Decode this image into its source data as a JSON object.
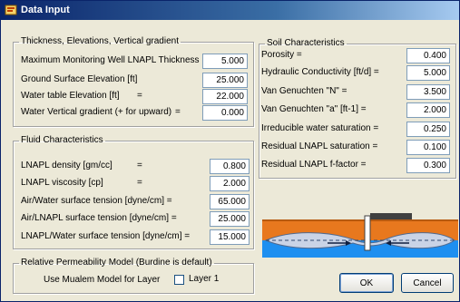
{
  "window": {
    "title": "Data Input",
    "icon": "app-window-icon"
  },
  "thickness_group": {
    "legend": "Thickness, Elevations, Vertical gradient",
    "fields": [
      {
        "label": "Maximum Monitoring Well LNAPL Thickness [ft] =",
        "value": "5.000"
      },
      {
        "label": "Ground Surface Elevation [ft]",
        "value": "25.000"
      },
      {
        "label": "Water table Elevation [ft]",
        "value": "22.000"
      },
      {
        "label": "Water Vertical gradient (+ for upward)",
        "value": "0.000"
      }
    ],
    "eq": "="
  },
  "fluid_group": {
    "legend": "Fluid Characteristics",
    "fields": [
      {
        "label": "LNAPL density [gm/cc]",
        "eq": "=",
        "value": "0.800"
      },
      {
        "label": "LNAPL viscosity [cp]",
        "eq": "=",
        "value": "2.000"
      },
      {
        "label": "Air/Water surface tension [dyne/cm]  =",
        "value": "65.000"
      },
      {
        "label": "Air/LNAPL surface tension [dyne/cm]  =",
        "value": "25.000"
      },
      {
        "label": "LNAPL/Water surface tension [dyne/cm] =",
        "value": "15.000"
      }
    ]
  },
  "soil_group": {
    "legend": "Soil Characteristics",
    "fields": [
      {
        "label": "Porosity =",
        "value": "0.400"
      },
      {
        "label": "Hydraulic Conductivity [ft/d]  =",
        "value": "5.000"
      },
      {
        "label": "Van Genuchten \"N\"  =",
        "value": "3.500"
      },
      {
        "label": "Van Genuchten \"a\"   [ft-1] =",
        "value": "2.000"
      },
      {
        "label": "Irreducible water saturation =",
        "value": "0.250"
      },
      {
        "label": "Residual LNAPL saturation  =",
        "value": "0.100"
      },
      {
        "label": "Residual LNAPL f-factor =",
        "value": "0.300"
      }
    ]
  },
  "permeability_group": {
    "legend": "Relative Permeability Model (Burdine is default)",
    "caption": "Use Mualem Model for Layer",
    "checkbox_label": "Layer 1",
    "checked": false
  },
  "buttons": {
    "ok": "OK",
    "cancel": "Cancel"
  },
  "colors": {
    "soil": "#e8781e",
    "water": "#1e8ff0",
    "lnapl": "#c9d3e6",
    "well": "#404040"
  }
}
